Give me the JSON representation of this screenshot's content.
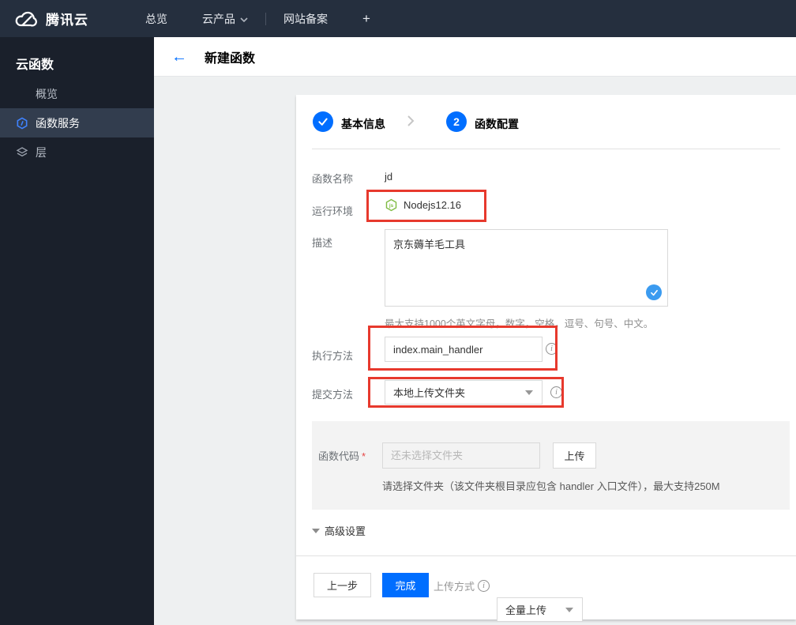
{
  "colors": {
    "accent": "#006eff",
    "annotation_red": "#e7392d",
    "node_green": "#7fbb42",
    "navbar_bg": "#252f3e",
    "sidebar_bg": "#1a202b",
    "sidebar_active_bg": "#323d4e",
    "content_bg": "#eef0f1"
  },
  "navbar": {
    "brand": "腾讯云",
    "items": [
      {
        "label": "总览"
      },
      {
        "label": "云产品"
      },
      {
        "label": "网站备案"
      },
      {
        "label": "+"
      }
    ]
  },
  "sidebar": {
    "title": "云函数",
    "items": [
      {
        "label": "概览",
        "icon": "grid-icon"
      },
      {
        "label": "函数服务",
        "icon": "scf-hexagon-icon",
        "active": true
      },
      {
        "label": "层",
        "icon": "layers-icon"
      }
    ]
  },
  "header": {
    "back_icon": "←",
    "title": "新建函数"
  },
  "steps": [
    {
      "label": "基本信息",
      "state": "done"
    },
    {
      "number": "2",
      "label": "函数配置",
      "state": "current"
    }
  ],
  "form": {
    "name": {
      "label": "函数名称",
      "value": "jd"
    },
    "runtime": {
      "label": "运行环境",
      "value": "Nodejs12.16",
      "icon": "nodejs-icon"
    },
    "description": {
      "label": "描述",
      "value": "京东薅羊毛工具",
      "hint": "最大支持1000个英文字母，数字，空格，逗号、句号、中文。"
    },
    "handler": {
      "label": "执行方法",
      "value": "index.main_handler"
    },
    "submit_method": {
      "label": "提交方法",
      "value": "本地上传文件夹"
    },
    "code": {
      "label": "函数代码",
      "required_mark": "*",
      "placeholder": "还未选择文件夹",
      "upload_button": "上传",
      "hint": "请选择文件夹（该文件夹根目录应包含 handler 入口文件），最大支持250M"
    }
  },
  "advanced": {
    "label": "高级设置"
  },
  "footer": {
    "prev_button": "上一步",
    "finish_button": "完成",
    "upload_mode_label": "上传方式",
    "upload_mode_value": "全量上传"
  }
}
